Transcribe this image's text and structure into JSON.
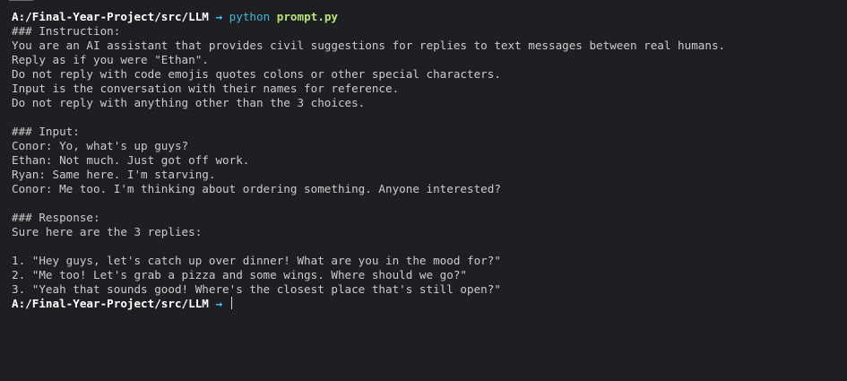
{
  "prompt": {
    "path": "A:/Final-Year-Project/src/LLM",
    "arrow": "→",
    "command": "python",
    "argument": "prompt.py"
  },
  "output_lines": [
    "### Instruction:",
    "You are an AI assistant that provides civil suggestions for replies to text messages between real humans.",
    "Reply as if you were \"Ethan\".",
    "Do not reply with code emojis quotes colons or other special characters.",
    "Input is the conversation with their names for reference.",
    "Do not reply with anything other than the 3 choices.",
    "",
    "### Input:",
    "Conor: Yo, what's up guys?",
    "Ethan: Not much. Just got off work.",
    "Ryan: Same here. I'm starving.",
    "Conor: Me too. I'm thinking about ordering something. Anyone interested?",
    "",
    "### Response:",
    "Sure here are the 3 replies:",
    "",
    "1. \"Hey guys, let's catch up over dinner! What are you in the mood for?\"",
    "2. \"Me too! Let's grab a pizza and some wings. Where should we go?\"",
    "3. \"Yeah that sounds good! Where's the closest place that's still open?\""
  ],
  "final_prompt": {
    "path": "A:/Final-Year-Project/src/LLM",
    "arrow": "→"
  },
  "colors": {
    "background": "#1e1f22",
    "text": "#cccccc",
    "path": "#ffffff",
    "arrow": "#4fc1ff",
    "command": "#3fb8d8",
    "argument": "#b9e37a"
  }
}
